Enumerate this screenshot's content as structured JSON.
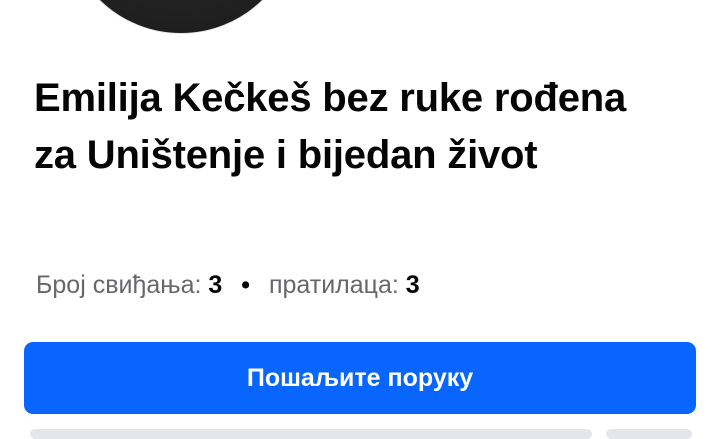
{
  "profile": {
    "name": "Emilija Kečkeš bez ruke rođena za Uništenje i bijedan život",
    "likes_label": "Број свиђања:",
    "likes_count": "3",
    "separator": "•",
    "followers_label": "пратилаца:",
    "followers_count": "3"
  },
  "actions": {
    "message_label": "Пошаљите поруку"
  },
  "colors": {
    "accent": "#0866ff",
    "text_primary": "#050505",
    "text_secondary": "#65676b"
  }
}
